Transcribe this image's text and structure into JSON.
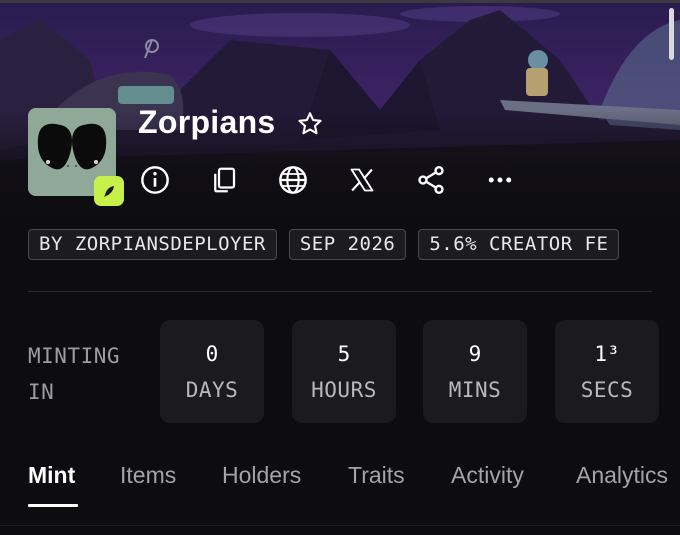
{
  "collection": {
    "name": "Zorpians",
    "avatar_icon": "alien-face-icon",
    "creator_badge_icon": "quill-icon",
    "banner_theme": "purple-alien-planet-night"
  },
  "actions": [
    {
      "name": "info-button",
      "icon": "info-icon"
    },
    {
      "name": "copy-button",
      "icon": "copy-icon"
    },
    {
      "name": "website-button",
      "icon": "globe-icon"
    },
    {
      "name": "x-button",
      "icon": "x-logo-icon"
    },
    {
      "name": "share-button",
      "icon": "share-icon"
    },
    {
      "name": "more-button",
      "icon": "ellipsis-icon"
    }
  ],
  "tags": [
    "BY ZORPIANSDEPLOYER",
    "SEP 2026",
    "5.6% CREATOR FE"
  ],
  "minting": {
    "label_line1": "MINTING",
    "label_line2": "IN",
    "countdown": [
      {
        "value": "0",
        "unit": "DAYS"
      },
      {
        "value": "5",
        "unit": "HOURS"
      },
      {
        "value": "9",
        "unit": "MINS"
      },
      {
        "value": "1³",
        "unit": "SECS"
      }
    ]
  },
  "tabs": [
    "Mint",
    "Items",
    "Holders",
    "Traits",
    "Activity",
    "Analytics"
  ],
  "active_tab": "Mint",
  "colors": {
    "background": "#0d0d0f",
    "badge_accent": "#c6f04a",
    "countdown_box": "#1b1b1f",
    "tag_border": "#4a4a50"
  }
}
